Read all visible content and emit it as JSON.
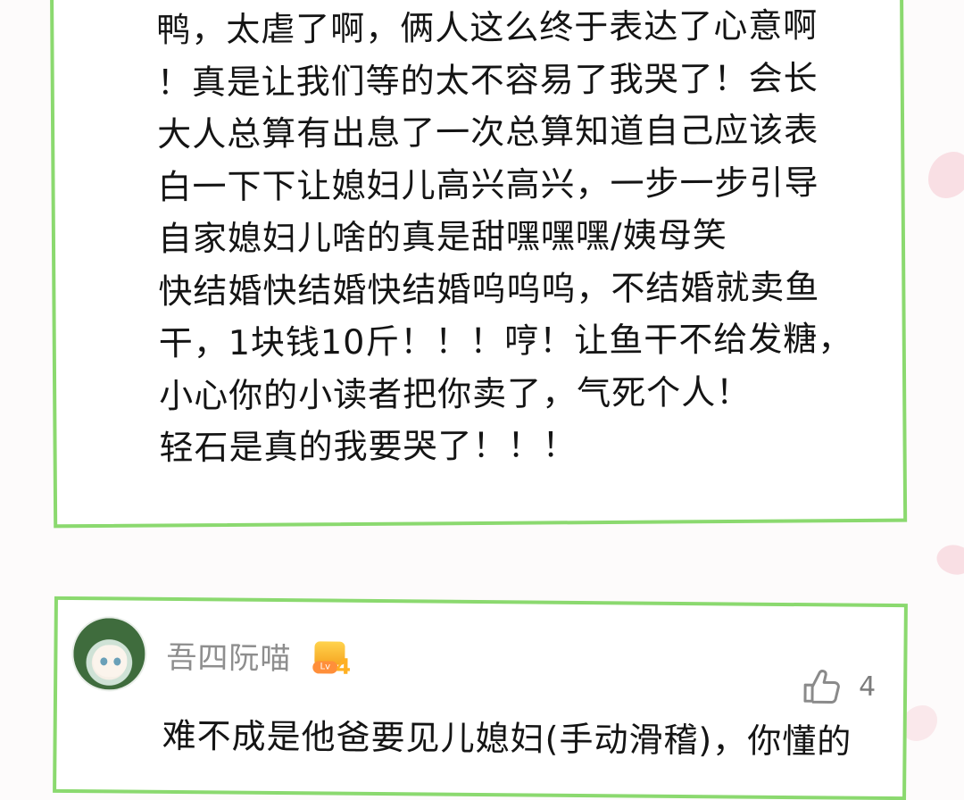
{
  "comment_1": {
    "lines": [
      "鸭，太虐了啊，俩人这么终于表达了心意啊",
      "！真是让我们等的太不容易了我哭了！会长",
      "大人总算有出息了一次总算知道自己应该表",
      "白一下下让媳妇儿高兴高兴，一步一步引导",
      "自家媳妇儿啥的真是甜嘿嘿嘿/姨母笑",
      "快结婚快结婚快结婚呜呜呜，不结婚就卖鱼",
      "干，1块钱10斤！！！哼！让鱼干不给发糖，",
      "小心你的小读者把你卖了，气死个人！",
      "轻石是真的我要哭了！！！"
    ]
  },
  "comment_2": {
    "username": "吾四阮喵",
    "level": {
      "label": "Lv",
      "number": "4"
    },
    "likes": "4",
    "text": "难不成是他爸要见儿媳妇(手动滑稽)，你懂的"
  },
  "colors": {
    "card_border": "#8bd96f",
    "text": "#141414",
    "username": "#8e8e8e"
  }
}
